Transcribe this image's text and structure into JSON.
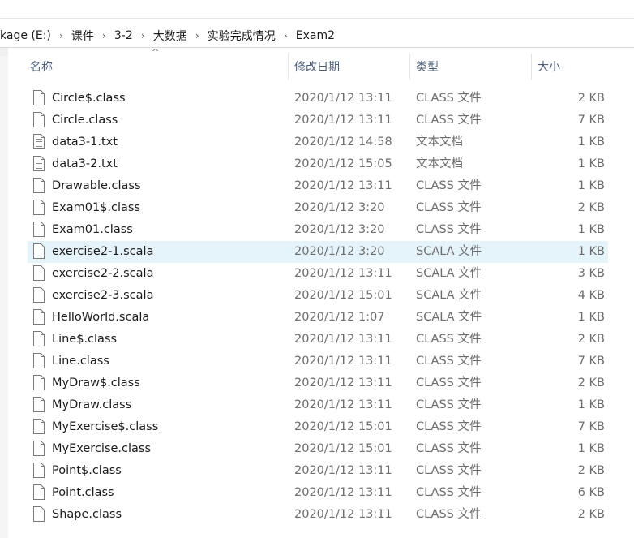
{
  "breadcrumb": {
    "items": [
      "kage (E:)",
      "课件",
      "3-2",
      "大数据",
      "实验完成情况",
      "Exam2"
    ],
    "separator": "›"
  },
  "columns": {
    "name": "名称",
    "modified": "修改日期",
    "type": "类型",
    "size": "大小"
  },
  "files": [
    {
      "name": "Circle$.class",
      "modified": "2020/1/12 13:11",
      "type": "CLASS 文件",
      "size": "2 KB",
      "icon": "blank-file-icon"
    },
    {
      "name": "Circle.class",
      "modified": "2020/1/12 13:11",
      "type": "CLASS 文件",
      "size": "7 KB",
      "icon": "blank-file-icon"
    },
    {
      "name": "data3-1.txt",
      "modified": "2020/1/12 14:58",
      "type": "文本文档",
      "size": "1 KB",
      "icon": "text-file-icon"
    },
    {
      "name": "data3-2.txt",
      "modified": "2020/1/12 15:05",
      "type": "文本文档",
      "size": "1 KB",
      "icon": "text-file-icon"
    },
    {
      "name": "Drawable.class",
      "modified": "2020/1/12 13:11",
      "type": "CLASS 文件",
      "size": "1 KB",
      "icon": "blank-file-icon"
    },
    {
      "name": "Exam01$.class",
      "modified": "2020/1/12 3:20",
      "type": "CLASS 文件",
      "size": "2 KB",
      "icon": "blank-file-icon"
    },
    {
      "name": "Exam01.class",
      "modified": "2020/1/12 3:20",
      "type": "CLASS 文件",
      "size": "1 KB",
      "icon": "blank-file-icon"
    },
    {
      "name": "exercise2-1.scala",
      "modified": "2020/1/12 3:20",
      "type": "SCALA 文件",
      "size": "1 KB",
      "icon": "blank-file-icon",
      "selected": true
    },
    {
      "name": "exercise2-2.scala",
      "modified": "2020/1/12 13:11",
      "type": "SCALA 文件",
      "size": "3 KB",
      "icon": "blank-file-icon"
    },
    {
      "name": "exercise2-3.scala",
      "modified": "2020/1/12 15:01",
      "type": "SCALA 文件",
      "size": "4 KB",
      "icon": "blank-file-icon"
    },
    {
      "name": "HelloWorld.scala",
      "modified": "2020/1/12 1:07",
      "type": "SCALA 文件",
      "size": "1 KB",
      "icon": "blank-file-icon"
    },
    {
      "name": "Line$.class",
      "modified": "2020/1/12 13:11",
      "type": "CLASS 文件",
      "size": "2 KB",
      "icon": "blank-file-icon"
    },
    {
      "name": "Line.class",
      "modified": "2020/1/12 13:11",
      "type": "CLASS 文件",
      "size": "7 KB",
      "icon": "blank-file-icon"
    },
    {
      "name": "MyDraw$.class",
      "modified": "2020/1/12 13:11",
      "type": "CLASS 文件",
      "size": "2 KB",
      "icon": "blank-file-icon"
    },
    {
      "name": "MyDraw.class",
      "modified": "2020/1/12 13:11",
      "type": "CLASS 文件",
      "size": "1 KB",
      "icon": "blank-file-icon"
    },
    {
      "name": "MyExercise$.class",
      "modified": "2020/1/12 15:01",
      "type": "CLASS 文件",
      "size": "7 KB",
      "icon": "blank-file-icon"
    },
    {
      "name": "MyExercise.class",
      "modified": "2020/1/12 15:01",
      "type": "CLASS 文件",
      "size": "1 KB",
      "icon": "blank-file-icon"
    },
    {
      "name": "Point$.class",
      "modified": "2020/1/12 13:11",
      "type": "CLASS 文件",
      "size": "2 KB",
      "icon": "blank-file-icon"
    },
    {
      "name": "Point.class",
      "modified": "2020/1/12 13:11",
      "type": "CLASS 文件",
      "size": "6 KB",
      "icon": "blank-file-icon"
    },
    {
      "name": "Shape.class",
      "modified": "2020/1/12 13:11",
      "type": "CLASS 文件",
      "size": "2 KB",
      "icon": "blank-file-icon"
    }
  ],
  "colors": {
    "selected_row": "#e5f3fb",
    "header_text": "#4c607a",
    "secondary_text": "#6d6d6d"
  }
}
